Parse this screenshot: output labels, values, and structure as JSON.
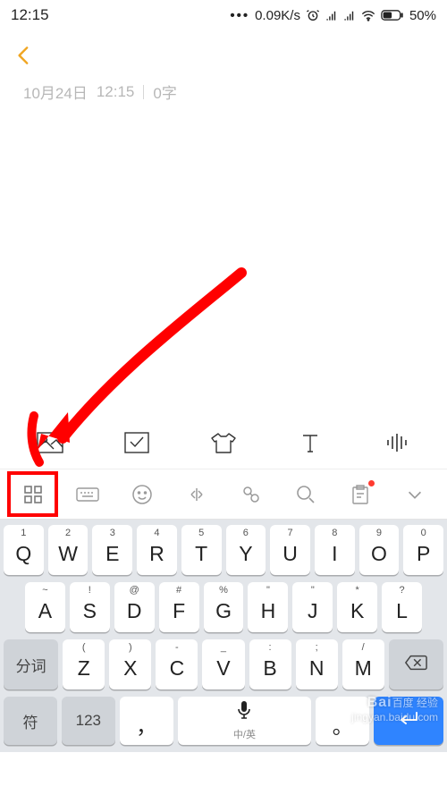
{
  "status": {
    "time": "12:15",
    "dots": "•••",
    "net_speed": "0.09K/s",
    "battery_pct": "50%"
  },
  "meta": {
    "date": "10月24日",
    "time": "12:15",
    "word_count": "0字"
  },
  "feature_bar": {
    "items": [
      "image-icon",
      "checklist-icon",
      "shirt-icon",
      "text-icon",
      "voice-wave-icon"
    ]
  },
  "ime_bar": {
    "items": [
      "grid-icon",
      "keyboard-icon",
      "emoji-icon",
      "cursor-icon",
      "link-icon",
      "search-icon",
      "clipboard-icon",
      "chevron-down-icon"
    ]
  },
  "keyboard": {
    "row1": [
      {
        "sup": "1",
        "main": "Q"
      },
      {
        "sup": "2",
        "main": "W"
      },
      {
        "sup": "3",
        "main": "E"
      },
      {
        "sup": "4",
        "main": "R"
      },
      {
        "sup": "5",
        "main": "T"
      },
      {
        "sup": "6",
        "main": "Y"
      },
      {
        "sup": "7",
        "main": "U"
      },
      {
        "sup": "8",
        "main": "I"
      },
      {
        "sup": "9",
        "main": "O"
      },
      {
        "sup": "0",
        "main": "P"
      }
    ],
    "row2": [
      {
        "sup": "~",
        "main": "A"
      },
      {
        "sup": "!",
        "main": "S"
      },
      {
        "sup": "@",
        "main": "D"
      },
      {
        "sup": "#",
        "main": "F"
      },
      {
        "sup": "%",
        "main": "G"
      },
      {
        "sup": "\"",
        "main": "H"
      },
      {
        "sup": "\"",
        "main": "J"
      },
      {
        "sup": "*",
        "main": "K"
      },
      {
        "sup": "?",
        "main": "L"
      }
    ],
    "row3": [
      {
        "sup": "(",
        "main": "Z"
      },
      {
        "sup": ")",
        "main": "X"
      },
      {
        "sup": "-",
        "main": "C"
      },
      {
        "sup": "_",
        "main": "V"
      },
      {
        "sup": ":",
        "main": "B"
      },
      {
        "sup": ";",
        "main": "N"
      },
      {
        "sup": "/",
        "main": "M"
      }
    ],
    "fenci": "分词",
    "fu": "符",
    "num": "123",
    "comma": "，",
    "lang": "中/英",
    "period": "。",
    "enter": "↵"
  },
  "watermark": {
    "brand": "Bai",
    "brand2": "百度",
    "label": "经验",
    "url": "jingyan.baidu.com"
  }
}
